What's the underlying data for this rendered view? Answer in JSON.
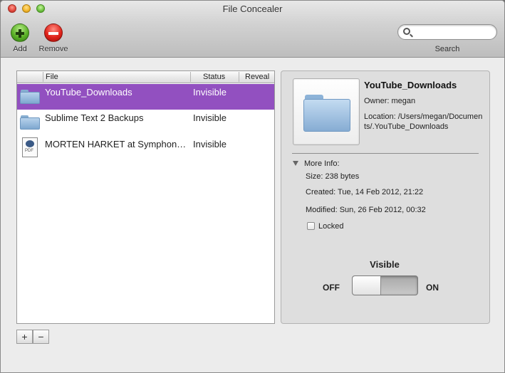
{
  "window": {
    "title": "File Concealer"
  },
  "toolbar": {
    "add_label": "Add",
    "remove_label": "Remove",
    "search_label": "Search",
    "search_value": "",
    "search_placeholder": ""
  },
  "list": {
    "columns": {
      "file": "File",
      "status": "Status",
      "reveal": "Reveal"
    },
    "rows": [
      {
        "name": "YouTube_Downloads",
        "status": "Invisible",
        "icon": "folder-icon",
        "selected": true
      },
      {
        "name": "Sublime Text 2 Backups",
        "status": "Invisible",
        "icon": "folder-icon",
        "selected": false
      },
      {
        "name": "MORTEN HARKET at Symphon…",
        "status": "Invisible",
        "icon": "pdf-document-icon",
        "selected": false
      }
    ],
    "add_symbol": "+",
    "remove_symbol": "−",
    "selection_color": "#9250c0"
  },
  "info": {
    "name": "YouTube_Downloads",
    "owner": "Owner: megan",
    "location": "Location: /Users/megan/Documents/.YouTube_Downloads",
    "more_info_label": "More Info:",
    "size": "Size: 238 bytes",
    "created": "Created: Tue, 14 Feb 2012, 21:22",
    "modified": "Modified: Sun, 26 Feb 2012, 00:32",
    "locked_label": "Locked",
    "locked_checked": false,
    "visible_label": "Visible",
    "off_label": "OFF",
    "on_label": "ON",
    "visible_state": "OFF"
  }
}
